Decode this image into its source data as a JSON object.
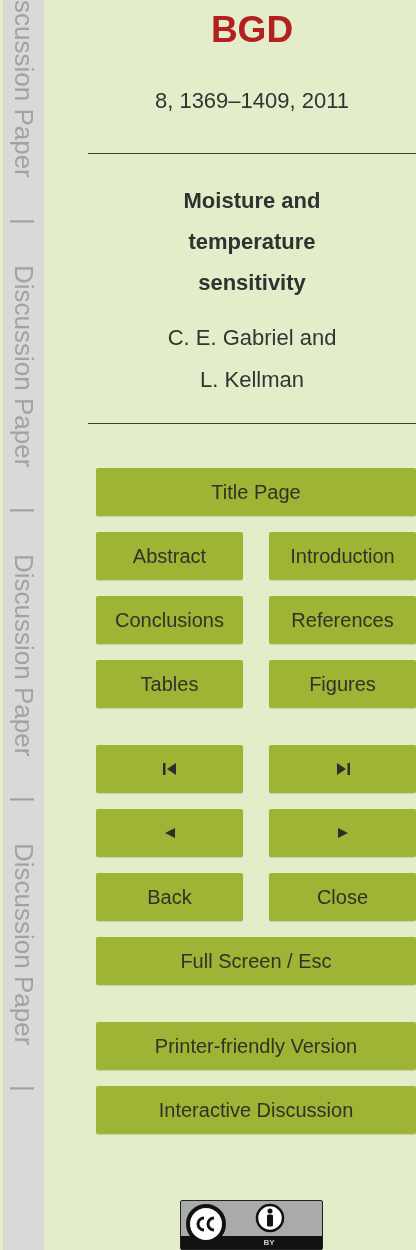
{
  "side_strip": [
    "scussion Paper",
    "|",
    "Discussion Paper",
    "|",
    "Discussion Paper",
    "|",
    "Discussion Paper",
    "|"
  ],
  "header": {
    "journal": "BGD",
    "citation": "8, 1369–1409, 2011",
    "title_lines": [
      "Moisture and",
      "temperature",
      "sensitivity"
    ],
    "author_lines": [
      "C. E. Gabriel and",
      "L. Kellman"
    ]
  },
  "nav_groups": [
    [
      [
        {
          "kind": "label",
          "label": "Title Page"
        }
      ],
      [
        {
          "kind": "label",
          "label": "Abstract"
        },
        {
          "kind": "label",
          "label": "Introduction"
        }
      ],
      [
        {
          "kind": "label",
          "label": "Conclusions"
        },
        {
          "kind": "label",
          "label": "References"
        }
      ],
      [
        {
          "kind": "label",
          "label": "Tables"
        },
        {
          "kind": "label",
          "label": "Figures"
        }
      ]
    ],
    [
      [
        {
          "kind": "first"
        },
        {
          "kind": "last"
        }
      ],
      [
        {
          "kind": "prev"
        },
        {
          "kind": "next"
        }
      ],
      [
        {
          "kind": "label",
          "label": "Back"
        },
        {
          "kind": "label",
          "label": "Close"
        }
      ],
      [
        {
          "kind": "label",
          "label": "Full Screen / Esc"
        }
      ]
    ],
    [
      [
        {
          "kind": "label",
          "label": "Printer-friendly Version"
        }
      ],
      [
        {
          "kind": "label",
          "label": "Interactive Discussion"
        }
      ]
    ]
  ],
  "license": {
    "label": "BY"
  }
}
